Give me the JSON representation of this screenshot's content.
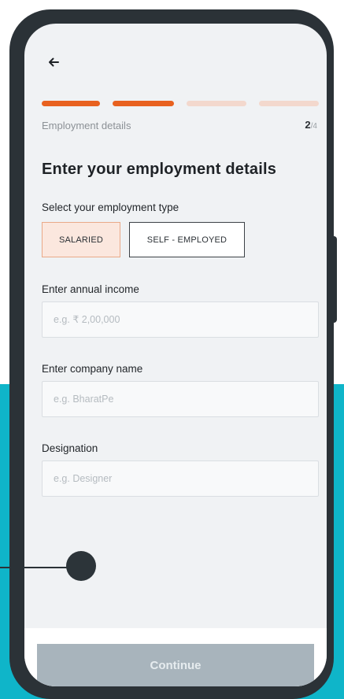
{
  "nav": {
    "back_icon": "arrow-left-icon"
  },
  "progress": {
    "total_steps": 4,
    "completed_steps": 2
  },
  "step": {
    "label": "Employment details",
    "current": "2",
    "total": "/4"
  },
  "page": {
    "title": "Enter your employment details"
  },
  "employment_type": {
    "label": "Select your employment type",
    "options": [
      "SALARIED",
      "SELF - EMPLOYED"
    ],
    "selected": "SALARIED"
  },
  "annual_income": {
    "label": "Enter annual income",
    "placeholder": "e.g. ₹ 2,00,000",
    "value": ""
  },
  "company": {
    "label": "Enter company name",
    "placeholder": "e.g. BharatPe",
    "value": ""
  },
  "designation": {
    "label": "Designation",
    "placeholder": "e.g. Designer",
    "value": ""
  },
  "continue_label": "Continue",
  "colors": {
    "accent": "#e8611f",
    "accent_light": "#f3d8cd",
    "teal_background": "#0fb5c9",
    "phone_frame": "#2b3237",
    "button_disabled": "#a8b4bc"
  }
}
